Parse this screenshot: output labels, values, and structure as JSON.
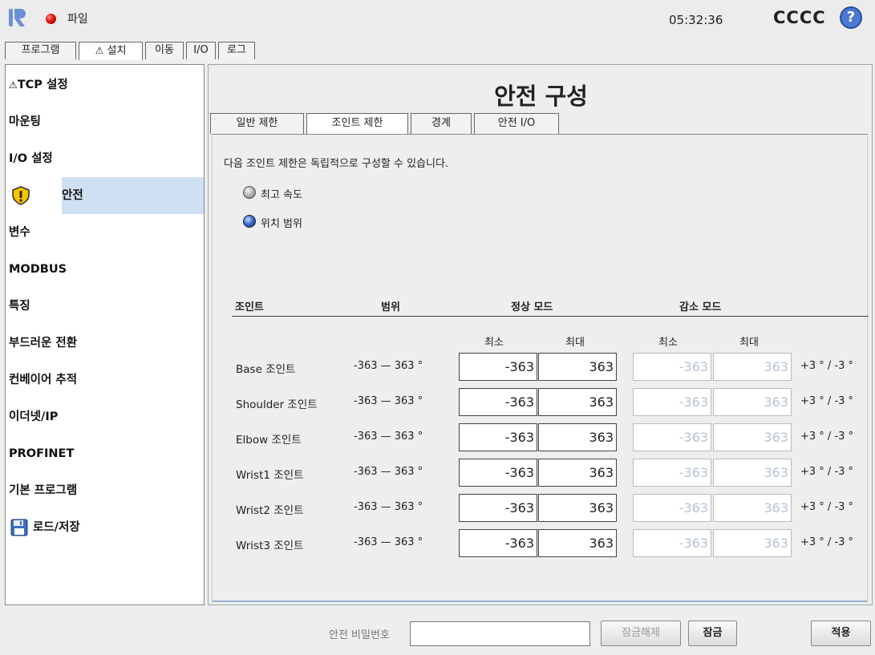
{
  "topbar": {
    "file_menu": "파일",
    "clock": "05:32:36",
    "robot_name": "CCCC",
    "help": "?"
  },
  "main_tabs": [
    {
      "label": "프로그램"
    },
    {
      "label": "설치",
      "warning": "⚠"
    },
    {
      "label": "이동"
    },
    {
      "label": "I/O"
    },
    {
      "label": "로그"
    }
  ],
  "sidebar": {
    "items": [
      {
        "label": "TCP 설정",
        "warning": "⚠"
      },
      {
        "label": "마운팅"
      },
      {
        "label": "I/O 설정"
      },
      {
        "label": "안전"
      },
      {
        "label": "변수"
      },
      {
        "label": "MODBUS"
      },
      {
        "label": "특징"
      },
      {
        "label": "부드러운 전환"
      },
      {
        "label": "컨베이어 추적"
      },
      {
        "label": "이더넷/IP"
      },
      {
        "label": "PROFINET"
      },
      {
        "label": "기본 프로그램"
      },
      {
        "label": "로드/저장"
      }
    ]
  },
  "main": {
    "title": "안전 구성",
    "subtabs": [
      {
        "label": "일반 제한"
      },
      {
        "label": "조인트 제한"
      },
      {
        "label": "경계"
      },
      {
        "label": "안전 I/O"
      }
    ],
    "description": "다음 조인트 제한은 독립적으로 구성할 수 있습니다.",
    "options": [
      {
        "label": "최고 속도",
        "selected": false
      },
      {
        "label": "위치 범위",
        "selected": true
      }
    ],
    "table": {
      "col_joint": "조인트",
      "col_range": "범위",
      "col_normal": "정상 모드",
      "col_reduced": "감소 모드",
      "min_label": "최소",
      "max_label": "최대",
      "rows": [
        {
          "joint": "Base 조인트",
          "range": "-363 — 363 °",
          "normal_min": "-363",
          "normal_max": "363",
          "reduced_min": "-363",
          "reduced_max": "363",
          "tolerance": "+3 ° / -3 °"
        },
        {
          "joint": "Shoulder 조인트",
          "range": "-363 — 363 °",
          "normal_min": "-363",
          "normal_max": "363",
          "reduced_min": "-363",
          "reduced_max": "363",
          "tolerance": "+3 ° / -3 °"
        },
        {
          "joint": "Elbow 조인트",
          "range": "-363 — 363 °",
          "normal_min": "-363",
          "normal_max": "363",
          "reduced_min": "-363",
          "reduced_max": "363",
          "tolerance": "+3 ° / -3 °"
        },
        {
          "joint": "Wrist1 조인트",
          "range": "-363 — 363 °",
          "normal_min": "-363",
          "normal_max": "363",
          "reduced_min": "-363",
          "reduced_max": "363",
          "tolerance": "+3 ° / -3 °"
        },
        {
          "joint": "Wrist2 조인트",
          "range": "-363 — 363 °",
          "normal_min": "-363",
          "normal_max": "363",
          "reduced_min": "-363",
          "reduced_max": "363",
          "tolerance": "+3 ° / -3 °"
        },
        {
          "joint": "Wrist3 조인트",
          "range": "-363 — 363 °",
          "normal_min": "-363",
          "normal_max": "363",
          "reduced_min": "-363",
          "reduced_max": "363",
          "tolerance": "+3 ° / -3 °"
        }
      ]
    }
  },
  "bottom": {
    "password_label": "안전 비밀번호",
    "password_value": "",
    "unlock_label": "잠금해제",
    "lock_label": "잠금",
    "apply_label": "적용"
  },
  "colors": {
    "active_sidebar": "#cfe0f2",
    "status_dot": "#e0140c",
    "help_icon": "#4b7ad0"
  }
}
